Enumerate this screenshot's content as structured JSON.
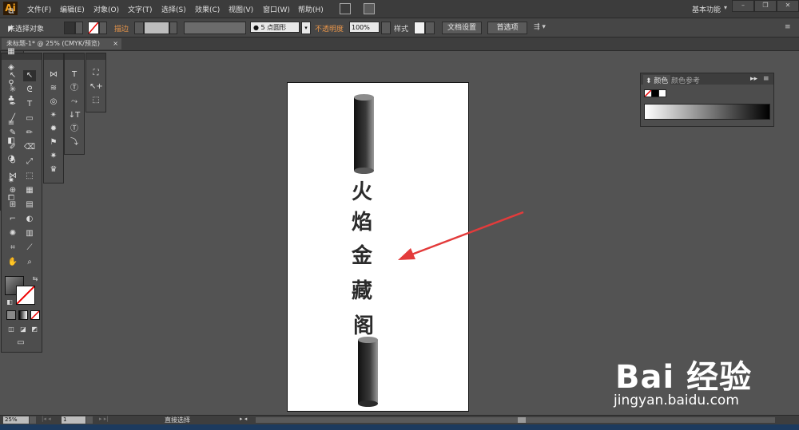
{
  "app": {
    "logo": "Ai"
  },
  "menu": {
    "items": [
      "文件(F)",
      "编辑(E)",
      "对象(O)",
      "文字(T)",
      "选择(S)",
      "效果(C)",
      "视图(V)",
      "窗口(W)",
      "帮助(H)"
    ],
    "workspace": "基本功能",
    "workspace_icon": "chevron-down-icon"
  },
  "controlbar": {
    "selection": "未选择对象",
    "stroke_label": "描边",
    "brush": "5 点圆形",
    "opacity_label": "不透明度",
    "opacity_value": "100%",
    "style_label": "样式",
    "doc_setup": "文档设置",
    "preferences": "首选项"
  },
  "document": {
    "tab_title": "未标题-1* @ 25% (CMYK/预览)",
    "close": "×"
  },
  "color_panel": {
    "tab_color": "颜色",
    "tab_guide": "颜色参考"
  },
  "status": {
    "zoom": "25%",
    "page": "1",
    "tool": "直接选择"
  },
  "artwork": {
    "characters": [
      "火",
      "焰",
      "金",
      "藏",
      "阁"
    ]
  },
  "watermark": {
    "logo": "Bai  经验",
    "url": "jingyan.baidu.com"
  },
  "colors": {
    "accent": "#f7a31c",
    "arrow": "#e33b3b",
    "ui_bg": "#535353"
  }
}
